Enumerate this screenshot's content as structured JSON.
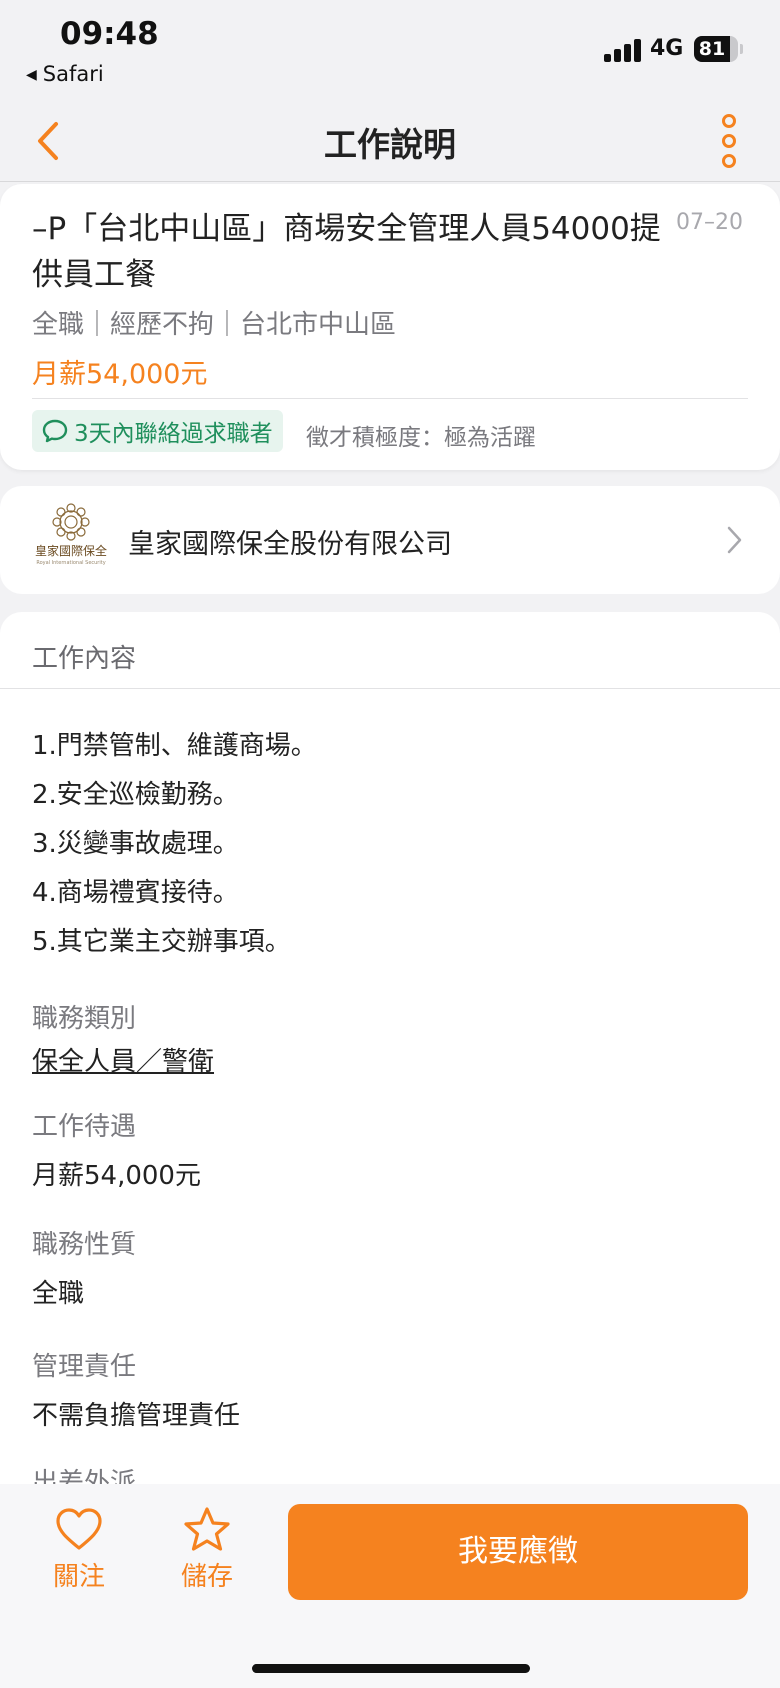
{
  "status_bar": {
    "time": "09:48",
    "back_app": "Safari",
    "network": "4G",
    "battery": "81"
  },
  "nav": {
    "title": "工作說明",
    "back_icon": "chevron-left-icon",
    "more_icon": "more-vertical-icon",
    "accent_color": "#f5821f"
  },
  "job": {
    "title": "–P「台北中山區」商場安全管理人員54000提供員工餐",
    "date": "07–20",
    "meta": "全職｜經歷不拘｜台北市中山區",
    "salary": "月薪54,000元",
    "badge": "3天內聯絡過求職者",
    "activity": "徵才積極度：極為活躍"
  },
  "company": {
    "name": "皇家國際保全股份有限公司",
    "logo_text": "皇家國際保全",
    "logo_sub": "Royal International Security"
  },
  "content": {
    "section_title": "工作內容",
    "duties": [
      "1.門禁管制、維護商場。",
      "2.安全巡檢勤務。",
      "3.災變事故處理。",
      "4.商場禮賓接待。",
      "5.其它業主交辦事項。"
    ],
    "fields": [
      {
        "label": "職務類別",
        "value": "保全人員／警衛"
      },
      {
        "label": "工作待遇",
        "value": "月薪54,000元"
      },
      {
        "label": "職務性質",
        "value": "全職"
      },
      {
        "label": "管理責任",
        "value": "不需負擔管理責任"
      },
      {
        "label": "出差外派",
        "value": ""
      }
    ]
  },
  "bottom_bar": {
    "follow_label": "關注",
    "save_label": "儲存",
    "apply_label": "我要應徵"
  }
}
